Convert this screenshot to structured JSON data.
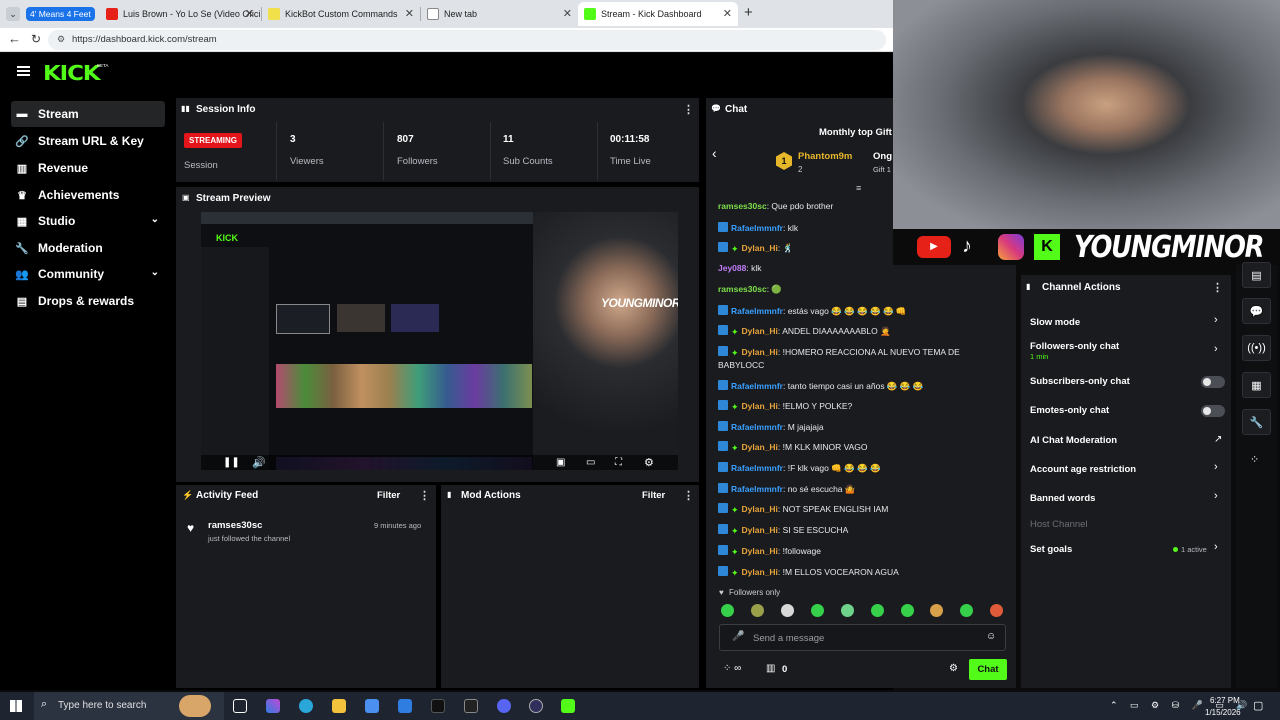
{
  "browser": {
    "tabs": [
      {
        "label": "4' Means 4 Feet",
        "color": "#1a73e8"
      },
      {
        "label": "Luis Brown - Yo Lo Se (Video Ofici...",
        "color": "#e62117"
      },
      {
        "label": "KickBot Custom Commands",
        "color": "#f2e04b"
      },
      {
        "label": "New tab",
        "color": "#ffffff"
      },
      {
        "label": "Stream - Kick Dashboard",
        "color": "#53fc18"
      }
    ],
    "url": "https://dashboard.kick.com/stream"
  },
  "kick": {
    "logo": "KICK",
    "logo_beta": "BETA",
    "sidebar": [
      {
        "label": "Stream",
        "icon": "broadcast-icon"
      },
      {
        "label": "Stream URL & Key",
        "icon": "link-icon"
      },
      {
        "label": "Revenue",
        "icon": "chart-icon"
      },
      {
        "label": "Achievements",
        "icon": "trophy-icon"
      },
      {
        "label": "Studio",
        "icon": "film-icon"
      },
      {
        "label": "Moderation",
        "icon": "wrench-icon"
      },
      {
        "label": "Community",
        "icon": "people-icon"
      },
      {
        "label": "Drops & rewards",
        "icon": "gift-icon"
      }
    ],
    "session": {
      "title": "Session Info",
      "status": "STREAMING",
      "status_label": "Session",
      "stats": [
        {
          "value": "3",
          "label": "Viewers"
        },
        {
          "value": "807",
          "label": "Followers"
        },
        {
          "value": "11",
          "label": "Sub Counts"
        },
        {
          "value": "00:11:58",
          "label": "Time Live"
        }
      ]
    },
    "preview": {
      "title": "Stream Preview",
      "overlay_name": "YOUNGMINOR",
      "preview_brand": "KICK"
    },
    "activity": {
      "title": "Activity Feed",
      "filter": "Filter",
      "items": [
        {
          "user": "ramses30sc",
          "action": "just followed the channel",
          "time": "9 minutes ago"
        }
      ]
    },
    "mod_actions": {
      "title": "Mod Actions",
      "filter": "Filter"
    },
    "chat": {
      "title": "Chat",
      "top_gifters_title": "Monthly top Gift",
      "top_gifter": {
        "rank": "1",
        "name": "Phantom9m",
        "count": "2",
        "second_name": "Ong",
        "second_sub": "Gift 1"
      },
      "messages": [
        {
          "user": "ramses30sc",
          "color": "#7fe04b",
          "badges": [],
          "text": "Que pdo brother"
        },
        {
          "user": "Rafaelmmnfr",
          "color": "#3aa0ff",
          "badges": [
            "mod"
          ],
          "text": "klk"
        },
        {
          "user": "Dylan_Hi",
          "color": "#e8a43a",
          "badges": [
            "mod",
            "vip"
          ],
          "text": "🕺"
        },
        {
          "user": "Jey088",
          "color": "#c07df7",
          "badges": [],
          "text": "klk"
        },
        {
          "user": "ramses30sc",
          "color": "#7fe04b",
          "badges": [],
          "text": "🟢"
        },
        {
          "user": "Rafaelmmnfr",
          "color": "#3aa0ff",
          "badges": [
            "mod"
          ],
          "text": "estás vago 😂 😂 😂 😂 😂 👊"
        },
        {
          "user": "Dylan_Hi",
          "color": "#e8a43a",
          "badges": [
            "mod",
            "vip"
          ],
          "text": "ANDEL DIAAAAAAABLO 🤦"
        },
        {
          "user": "Dylan_Hi",
          "color": "#e8a43a",
          "badges": [
            "mod",
            "vip"
          ],
          "text": "!HOMERO REACCIONA AL NUEVO TEMA DE"
        },
        {
          "user": "",
          "color": "#e8e8e8",
          "badges": [],
          "text": "BABYLOCC"
        },
        {
          "user": "Rafaelmmnfr",
          "color": "#3aa0ff",
          "badges": [
            "mod"
          ],
          "text": "tanto tiempo casi un años 😂 😂 😂"
        },
        {
          "user": "Dylan_Hi",
          "color": "#e8a43a",
          "badges": [
            "mod",
            "vip"
          ],
          "text": "!ELMO Y POLKE?"
        },
        {
          "user": "Rafaelmmnfr",
          "color": "#3aa0ff",
          "badges": [
            "mod"
          ],
          "text": "M jajajaja"
        },
        {
          "user": "Dylan_Hi",
          "color": "#e8a43a",
          "badges": [
            "mod",
            "vip"
          ],
          "text": "!M KLK MINOR VAGO"
        },
        {
          "user": "Rafaelmmnfr",
          "color": "#3aa0ff",
          "badges": [
            "mod"
          ],
          "text": "!F klk vago 👊 😂 😂 😂"
        },
        {
          "user": "Rafaelmmnfr",
          "color": "#3aa0ff",
          "badges": [
            "mod"
          ],
          "text": "no sé escucha 🤷"
        },
        {
          "user": "Dylan_Hi",
          "color": "#e8a43a",
          "badges": [
            "mod",
            "vip"
          ],
          "text": "NOT SPEAK ENGLISH IAM"
        },
        {
          "user": "Dylan_Hi",
          "color": "#e8a43a",
          "badges": [
            "mod",
            "vip"
          ],
          "text": "SI SE ESCUCHA"
        },
        {
          "user": "Dylan_Hi",
          "color": "#e8a43a",
          "badges": [
            "mod",
            "vip"
          ],
          "text": "!followage"
        },
        {
          "user": "Dylan_Hi",
          "color": "#e8a43a",
          "badges": [
            "mod",
            "vip"
          ],
          "text": "!M ELLOS VOCEARON AGUA"
        }
      ],
      "followers_only": "Followers only",
      "placeholder": "Send a message",
      "points": "0",
      "send": "Chat"
    },
    "channel_actions": {
      "title": "Channel Actions",
      "rows": [
        {
          "label": "Slow mode",
          "type": "arrow"
        },
        {
          "label": "Followers-only chat",
          "sub": "1 min",
          "type": "arrow"
        },
        {
          "label": "Subscribers-only chat",
          "type": "toggle"
        },
        {
          "label": "Emotes-only chat",
          "type": "toggle"
        },
        {
          "label": "AI Chat Moderation",
          "type": "external"
        },
        {
          "label": "Account age restriction",
          "type": "arrow"
        },
        {
          "label": "Banned words",
          "type": "arrow"
        },
        {
          "label": "Host Channel",
          "type": "disabled"
        },
        {
          "label": "Set goals",
          "status": "1 active",
          "type": "arrow"
        }
      ]
    },
    "overlay": {
      "name": "YOUNGMINOR"
    }
  },
  "taskbar": {
    "search_placeholder": "Type here to search",
    "time": "6:27 PM",
    "date": "1/15/2026"
  },
  "colors": {
    "kick_green": "#53fc18",
    "streaming_red": "#e3151b",
    "panel": "#191b1f"
  }
}
